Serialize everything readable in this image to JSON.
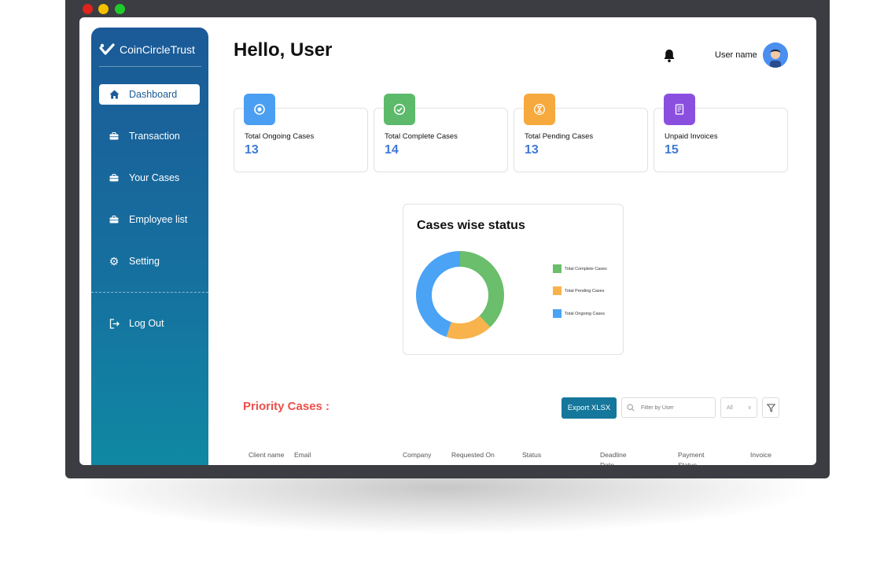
{
  "window": {
    "controls": [
      {
        "name": "close",
        "color": "#e0231c"
      },
      {
        "name": "minimize",
        "color": "#f5c000"
      },
      {
        "name": "maximize",
        "color": "#1fcb2b"
      }
    ]
  },
  "brand": {
    "name": "CoinCircleTrust",
    "icon": "check-heart-icon"
  },
  "sidebar": {
    "items": [
      {
        "label": "Dashboard",
        "icon": "home-icon",
        "active": true
      },
      {
        "label": "Transaction",
        "icon": "briefcase-icon"
      },
      {
        "label": "Your Cases",
        "icon": "briefcase-icon"
      },
      {
        "label": "Employee list",
        "icon": "briefcase-icon"
      },
      {
        "label": "Setting",
        "icon": "gear-icon"
      }
    ],
    "logout": {
      "label": "Log Out",
      "icon": "logout-icon"
    }
  },
  "header": {
    "greeting": "Hello, User",
    "username": "User name",
    "notification_icon": "bell-icon",
    "avatar_icon": "user-avatar-icon"
  },
  "stats": [
    {
      "label": "Total Ongoing Cases",
      "value": "13",
      "color": "#4a9ff2",
      "icon": "target-icon"
    },
    {
      "label": "Total Complete Cases",
      "value": "14",
      "color": "#5cba6a",
      "icon": "check-circle-icon"
    },
    {
      "label": "Total Pending Cases",
      "value": "13",
      "color": "#f6a93c",
      "icon": "hourglass-icon"
    },
    {
      "label": "Unpaid Invoices",
      "value": "15",
      "color": "#8b4fe0",
      "icon": "invoice-icon"
    }
  ],
  "chart_data": {
    "type": "donut",
    "title": "Cases wise status",
    "series": [
      {
        "name": "Total Complete Cases",
        "value": 38,
        "color": "#6bbe6c"
      },
      {
        "name": "Total Pending Cases",
        "value": 17,
        "color": "#f8b34c"
      },
      {
        "name": "Total  Ongoing Cases",
        "value": 45,
        "color": "#4aa3f5"
      }
    ],
    "legend_position": "right"
  },
  "priority": {
    "title": "Priority Cases :",
    "export_label": "Export XLSX",
    "filter_placeholder": "Filter by User",
    "select_value": "All",
    "select_arrow": "v",
    "columns": [
      "Client name",
      "Email",
      "Company",
      "Requested On",
      "Status",
      "Deadline Date",
      "Payment Status",
      "Invoice"
    ]
  }
}
